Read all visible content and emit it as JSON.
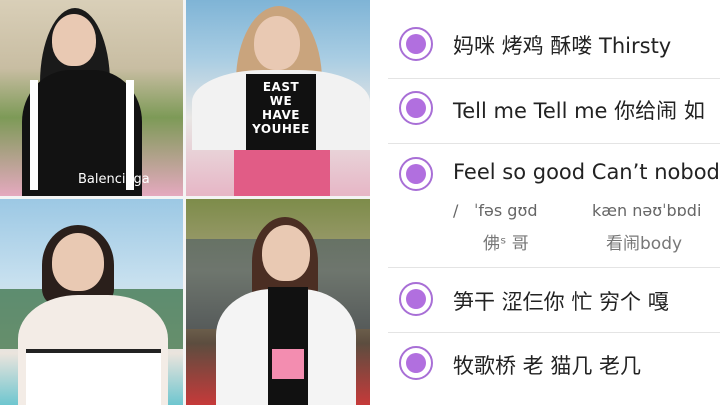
{
  "photos": [
    {
      "shirt_text": "",
      "brand_text": "Balenciaga"
    },
    {
      "shirt_text": "EAST\nWE\nHAVE\nYOUHEE",
      "brand_text": ""
    },
    {
      "shirt_text": "",
      "brand_text": ""
    },
    {
      "shirt_text": "",
      "brand_text": ""
    }
  ],
  "colors": {
    "accent": "#b16fdf",
    "radio_border": "#a86fd6",
    "divider": "#e4e4e4"
  },
  "lyrics": [
    {
      "text": "妈咪 烤鸡 酥喽 Thirsty"
    },
    {
      "text": "Tell me Tell me 你给闹  如"
    },
    {
      "text": "Feel so good Can’t nobody",
      "slash": "/",
      "phonetic_1": "ˈfəs gʊd",
      "phonetic_2": "kæn nəʊˈbɒdi",
      "sub_1": "佛ˢ 哥",
      "sub_2": "看闹body"
    },
    {
      "text": "笋干  涩仨你   忙 穷个  嘎"
    },
    {
      "text": "牧歌桥  老  猫几 老几"
    }
  ]
}
